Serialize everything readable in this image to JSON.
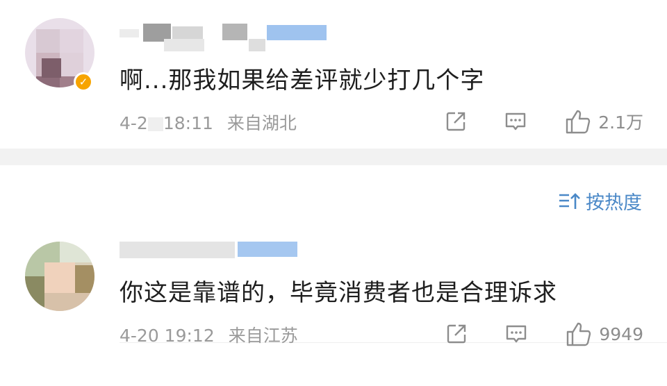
{
  "comment1": {
    "text": "啊...那我如果给差评就少打几个字",
    "time": "4-2",
    "time_tail": "18:11",
    "location": "来自湖北",
    "like_count": "2.1万",
    "verified_mark": "✓",
    "icons": [
      "share-icon",
      "comment-icon",
      "like-icon"
    ]
  },
  "sort": {
    "label": "按热度",
    "icon": "sort-icon"
  },
  "comment2": {
    "text": "你这是靠谱的，毕竟消费者也是合理诉求",
    "time": "4-20 19:12",
    "location": "来自江苏",
    "like_count": "9949",
    "icons": [
      "share-icon",
      "comment-icon",
      "like-icon"
    ]
  },
  "colors": {
    "link": "#4a88c7",
    "meta": "#9a9a9a",
    "separator": "#f2f2f2",
    "badge": "#f7a400"
  }
}
